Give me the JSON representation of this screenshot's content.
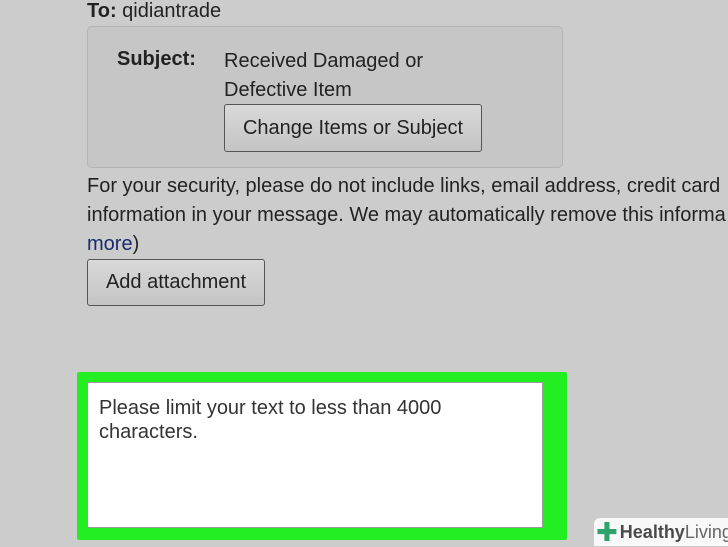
{
  "recipient": {
    "label": "To:",
    "value": "qidiantrade"
  },
  "subject_box": {
    "label": "Subject:",
    "value": "Received Damaged or Defective Item",
    "change_button": "Change Items or Subject"
  },
  "notice": {
    "line1": "For your security, please do not include links, email address, credit card",
    "line2": "information in your message. We may automatically remove this informa",
    "link_text": "more",
    "after_link": ")"
  },
  "attachment_button": "Add attachment",
  "message": {
    "placeholder": "Please limit your text to less than 4000 characters."
  },
  "watermark": {
    "icon": "plus-cross-icon",
    "word1": "Healthy",
    "word2": "Living"
  },
  "colors": {
    "background": "#cccccc",
    "highlight": "#22ee22",
    "link": "#1a2a6c",
    "watermark_icon": "#2fa36b"
  }
}
